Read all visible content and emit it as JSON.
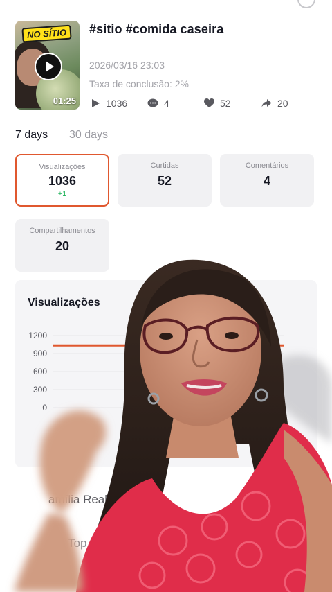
{
  "video": {
    "badge": "NO SÍTIO",
    "duration": "01:25",
    "title": "#sitio #comida caseira",
    "date": "2026/03/16 23:03",
    "completion_rate": "Taxa de conclusão: 2%",
    "stats": {
      "plays": "1036",
      "comments": "4",
      "likes": "52",
      "shares": "20"
    }
  },
  "tabs": [
    "7 days",
    "30 days"
  ],
  "metrics": [
    {
      "label": "Visualizações",
      "value": "1036",
      "delta": "+1"
    },
    {
      "label": "Curtidas",
      "value": "52"
    },
    {
      "label": "Comentários",
      "value": "4"
    },
    {
      "label": "Compartilhamentos",
      "value": "20"
    }
  ],
  "chart_data": {
    "type": "line",
    "title": "Visualizações",
    "y_ticks": [
      "1200",
      "900",
      "600",
      "300",
      "0"
    ],
    "ylim": [
      0,
      1200
    ],
    "series": [
      {
        "values": [
          1036,
          1036,
          1036,
          1036,
          1036,
          1036,
          1036
        ]
      }
    ],
    "line_color": "#e0582f"
  },
  "sections": {
    "family_label": "amília Real",
    "top_label": "Top Cr"
  },
  "colors": {
    "accent": "#e0582f",
    "positive": "#20b35a",
    "card_bg": "#f1f1f3"
  }
}
